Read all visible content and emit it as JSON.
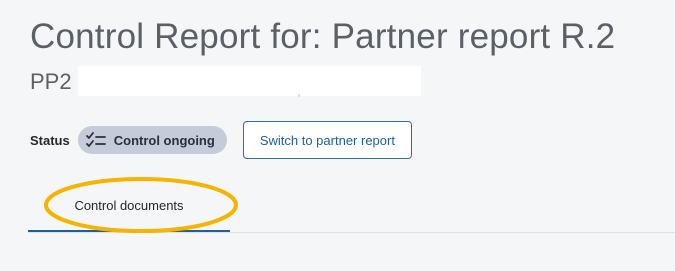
{
  "header": {
    "title": "Control Report for: Partner report R.2",
    "subtitle": "PP2"
  },
  "status": {
    "label": "Status",
    "badge_text": "Control ongoing",
    "badge_icon": "checklist-icon",
    "badge_color": "#c3ccd8"
  },
  "actions": {
    "switch_label": "Switch to partner report"
  },
  "tabs": [
    {
      "label": "Control documents",
      "active": true
    }
  ],
  "annotation": {
    "color": "#f5b400",
    "shape": "ellipse"
  },
  "colors": {
    "accent": "#1f5f9e",
    "title_text": "#5b6066",
    "background": "#f5f6f7"
  }
}
